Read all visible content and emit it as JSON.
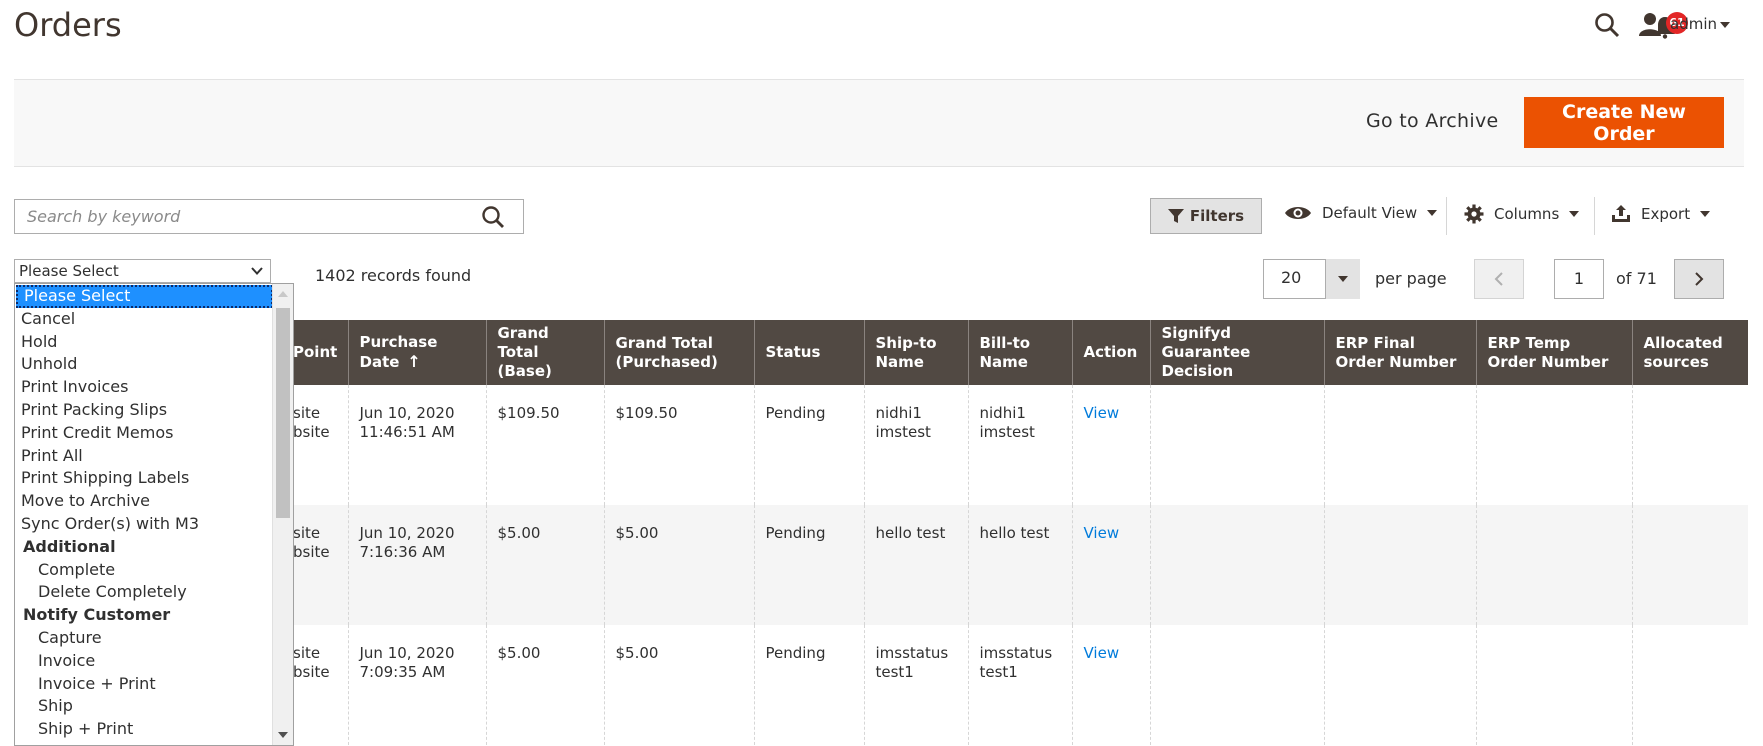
{
  "header": {
    "title": "Orders",
    "notifications_count": "61",
    "user_name": "admin"
  },
  "actions": {
    "archive_label": "Go to Archive",
    "create_label": "Create New Order"
  },
  "search": {
    "placeholder": "Search by keyword"
  },
  "toolbar": {
    "filters_label": "Filters",
    "view_label": "Default View",
    "columns_label": "Columns",
    "export_label": "Export"
  },
  "mass_action": {
    "selected": "Please Select",
    "options": [
      {
        "label": "Please Select",
        "kind": "selected"
      },
      {
        "label": "Cancel",
        "kind": "item"
      },
      {
        "label": "Hold",
        "kind": "item"
      },
      {
        "label": "Unhold",
        "kind": "item"
      },
      {
        "label": "Print Invoices",
        "kind": "item"
      },
      {
        "label": "Print Packing Slips",
        "kind": "item"
      },
      {
        "label": "Print Credit Memos",
        "kind": "item"
      },
      {
        "label": "Print All",
        "kind": "item"
      },
      {
        "label": "Print Shipping Labels",
        "kind": "item"
      },
      {
        "label": "Move to Archive",
        "kind": "item"
      },
      {
        "label": "Sync Order(s) with M3",
        "kind": "item"
      },
      {
        "label": "Additional",
        "kind": "group"
      },
      {
        "label": "Complete",
        "kind": "sub"
      },
      {
        "label": "Delete Completely",
        "kind": "sub"
      },
      {
        "label": "Notify Customer",
        "kind": "group"
      },
      {
        "label": "Capture",
        "kind": "sub"
      },
      {
        "label": "Invoice",
        "kind": "sub"
      },
      {
        "label": "Invoice + Print",
        "kind": "sub"
      },
      {
        "label": "Ship",
        "kind": "sub"
      },
      {
        "label": "Ship + Print",
        "kind": "sub"
      }
    ]
  },
  "records_found": "1402 records found",
  "pagination": {
    "per_page": "20",
    "per_page_label": "per page",
    "current_page": "1",
    "total_label": "of 71"
  },
  "grid": {
    "columns": [
      "Point",
      "Purchase Date",
      "Grand Total (Base)",
      "Grand Total (Purchased)",
      "Status",
      "Ship-to Name",
      "Bill-to Name",
      "Action",
      "Signifyd Guarantee Decision",
      "ERP Final Order Number",
      "ERP Temp Order Number",
      "Allocated sources"
    ],
    "sort_indicator": "↑",
    "rows": [
      {
        "point": "site\nbsite",
        "date": "Jun 10, 2020\n11:46:51 AM",
        "base": "$109.50",
        "purchased": "$109.50",
        "status": "Pending",
        "ship": "nidhi1\nimstest",
        "bill": "nidhi1\nimstest",
        "action": "View",
        "signifyd": "",
        "erp_final": "",
        "erp_temp": "",
        "sources": ""
      },
      {
        "point": "site\nbsite",
        "date": "Jun 10, 2020\n7:16:36 AM",
        "base": "$5.00",
        "purchased": "$5.00",
        "status": "Pending",
        "ship": "hello test",
        "bill": "hello test",
        "action": "View",
        "signifyd": "",
        "erp_final": "",
        "erp_temp": "",
        "sources": ""
      },
      {
        "point": "site\nbsite",
        "date": "Jun 10, 2020\n7:09:35 AM",
        "base": "$5.00",
        "purchased": "$5.00",
        "status": "Pending",
        "ship": "imsstatus\ntest1",
        "bill": "imsstatus\ntest1",
        "action": "View",
        "signifyd": "",
        "erp_final": "",
        "erp_temp": "",
        "sources": ""
      }
    ]
  }
}
